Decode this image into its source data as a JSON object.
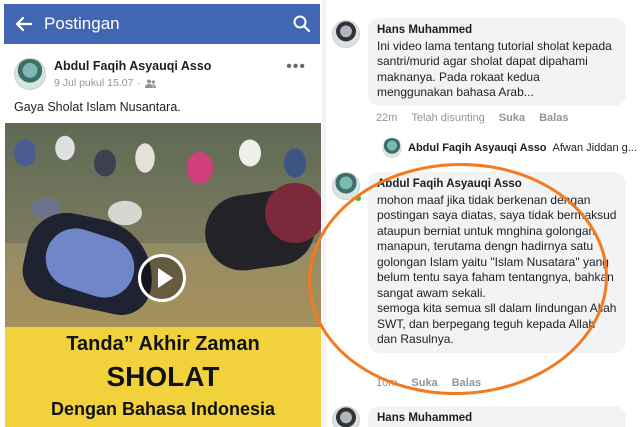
{
  "left": {
    "topbar": {
      "title": "Postingan"
    },
    "post": {
      "author": "Abdul Faqih Asyauqi Asso",
      "date": "9 Jul pukul 15.07",
      "caption": "Gaya Sholat Islam Nusantara."
    },
    "video": {
      "line1": "Tanda” Akhir Zaman",
      "line2": "SHOLAT",
      "line3": "Dengan Bahasa Indonesia"
    }
  },
  "right": {
    "comment1": {
      "author": "Hans Muhammed",
      "text": "Ini video lama tentang tutorial sholat kepada santri/murid agar sholat dapat dipahami maknanya. Pada rokaat kedua menggunakan bahasa Arab...",
      "time": "22m",
      "unsent": "Telah disunting",
      "like": "Suka",
      "reply": "Balas"
    },
    "reply_preview": {
      "author": "Abdul Faqih Asyauqi Asso",
      "text": "Afwan Jiddan g..."
    },
    "comment2": {
      "author": "Abdul Faqih Asyauqi Asso",
      "para1": "mohon maaf jika tidak berkenan dengan postingan saya diatas, saya tidak bermaksud ataupun berniat untuk mnghina golongan manapun, terutama dengn hadirnya  satu golongan Islam yaitu \"Islam Nusatara\" yang belum tentu saya faham tentangnya, bahkan sangat awam sekali.",
      "para2": "semoga kita semua sll dalam lindungan Allah SWT, dan berpegang teguh kepada Allah dan Rasulnya.",
      "time": "10m",
      "like": "Suka",
      "reply": "Balas"
    },
    "comment3": {
      "author": "Hans Muhammed"
    }
  },
  "colors": {
    "facebook_blue": "#4267b2",
    "highlight": "#f37a1f",
    "banner": "#f2d23c"
  },
  "icons": [
    "back-arrow-icon",
    "search-icon",
    "friends-icon",
    "more-icon",
    "play-icon"
  ]
}
